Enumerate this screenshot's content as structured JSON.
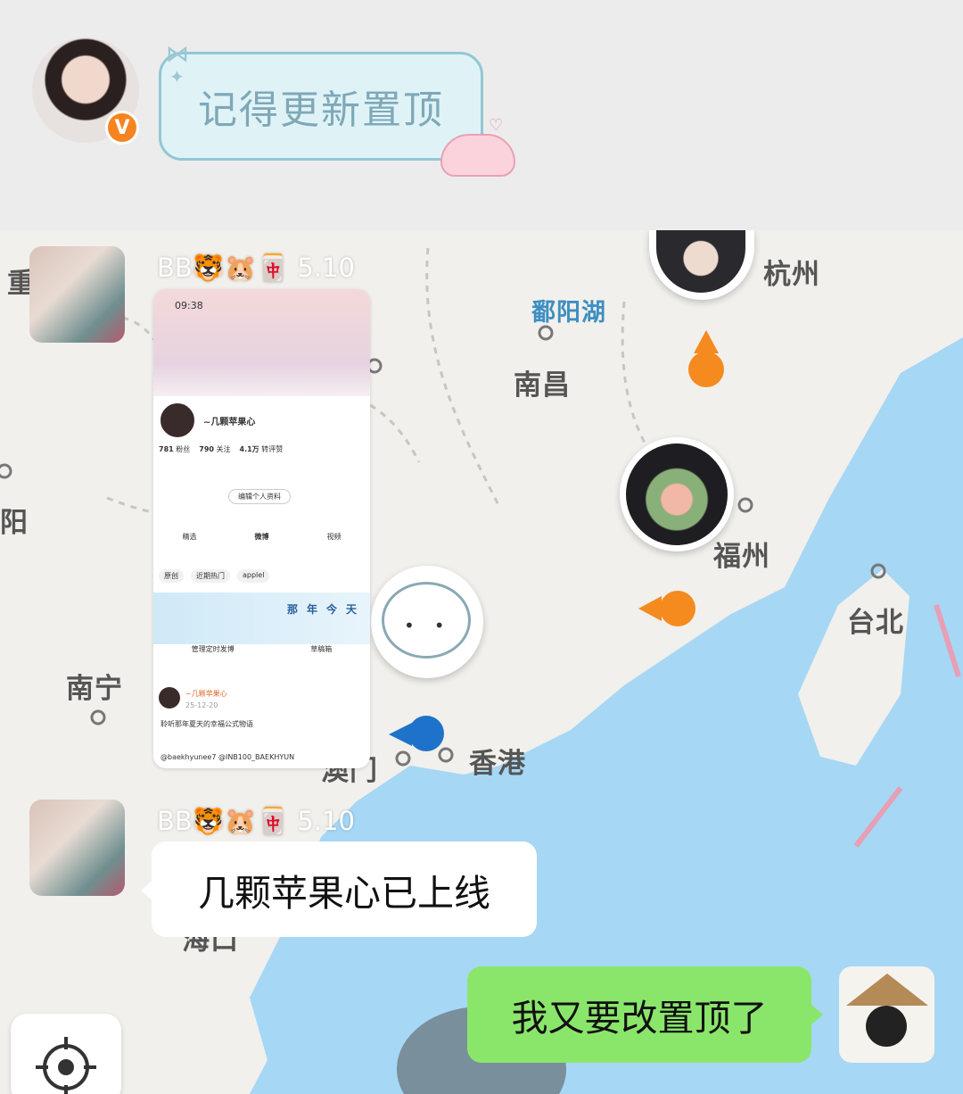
{
  "header": {
    "sticker_text": "记得更新置顶",
    "verified_badge": "V"
  },
  "map": {
    "cities": [
      "杭州",
      "鄱阳湖",
      "南昌",
      "福州",
      "台北",
      "香港",
      "南宁",
      "澳门",
      "海口",
      "阳",
      "重"
    ]
  },
  "messages": [
    {
      "sender": "BB🐯🐹🀄️ 5.10",
      "type": "image"
    },
    {
      "sender": "BB🐯🐹🀄️ 5.10",
      "type": "text",
      "text": "几颗苹果心已上线"
    },
    {
      "sender": "",
      "type": "text",
      "self": true,
      "text": "我又要改置顶了"
    }
  ],
  "screenshot": {
    "time": "09:38",
    "profile_name": "~几颗苹果心",
    "stats": [
      {
        "value": "781",
        "label": "粉丝"
      },
      {
        "value": "790",
        "label": "关注"
      },
      {
        "value": "4.1万",
        "label": "转评赞"
      }
    ],
    "edit_button": "编辑个人资料",
    "tabs": [
      "精选",
      "微博",
      "视频"
    ],
    "filters": [
      "原创",
      "近期热门",
      "applel"
    ],
    "banner_chars": [
      "那",
      "年",
      "今",
      "天"
    ],
    "actions": [
      "管理定时发博",
      "草稿箱"
    ],
    "post_author": "~几颗苹果心",
    "post_date": "25-12-20",
    "post_text": "聆听那年夏天的幸福公式物语",
    "post_tags": "@baekhyunee7 @INB100_BAEKHYUN"
  },
  "locate_icon": "locate-icon"
}
